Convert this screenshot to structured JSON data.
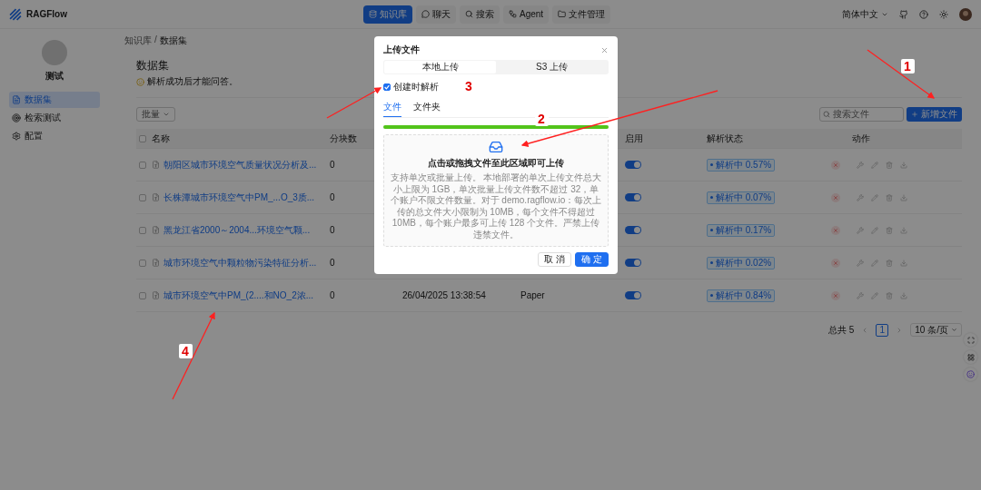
{
  "header": {
    "logo": "RAGFlow",
    "nav": [
      {
        "label": "知识库",
        "selected": true
      },
      {
        "label": "聊天",
        "selected": false
      },
      {
        "label": "搜索",
        "selected": false
      },
      {
        "label": "Agent",
        "selected": false
      },
      {
        "label": "文件管理",
        "selected": false
      }
    ],
    "language": "简体中文"
  },
  "sidebar": {
    "name": "测试",
    "items": [
      {
        "label": "数据集",
        "selected": true
      },
      {
        "label": "检索测试",
        "selected": false
      },
      {
        "label": "配置",
        "selected": false
      }
    ]
  },
  "breadcrumb": {
    "items": [
      "知识库",
      "数据集"
    ],
    "separator": "/"
  },
  "page": {
    "title": "数据集",
    "subtitle": "解析成功后才能问答。"
  },
  "toolbar": {
    "batch": "批量",
    "search_placeholder": "搜索文件",
    "add_button": "新增文件"
  },
  "table": {
    "select_all_checked": false,
    "columns": [
      "名称",
      "分块数",
      "",
      "",
      "启用",
      "解析状态",
      "动作"
    ],
    "rows": [
      {
        "checked": false,
        "name": "朝阳区城市环境空气质量状况分析及...",
        "chunks": "0",
        "enabled": true,
        "status": "解析中",
        "progress": "0.57%"
      },
      {
        "checked": false,
        "name": "长株潭城市环境空气中PM_...O_3质...",
        "chunks": "0",
        "enabled": true,
        "status": "解析中",
        "progress": "0.07%"
      },
      {
        "checked": false,
        "name": "黑龙江省2000～2004...环境空气颗...",
        "chunks": "0",
        "enabled": true,
        "status": "解析中",
        "progress": "0.17%"
      },
      {
        "checked": false,
        "name": "城市环境空气中颗粒物污染特征分析...",
        "chunks": "0",
        "enabled": true,
        "status": "解析中",
        "progress": "0.02%"
      },
      {
        "checked": false,
        "name": "城市环境空气中PM_(2....和NO_2浓...",
        "chunks": "0",
        "date": "26/04/2025 13:38:54",
        "method": "Paper",
        "enabled": true,
        "status": "解析中",
        "progress": "0.84%"
      }
    ]
  },
  "pagination": {
    "total": "总共 5",
    "pages": [
      {
        "label": "1",
        "selected": true
      }
    ],
    "page_size": "10 条/页"
  },
  "dialog": {
    "title": "上传文件",
    "modes": [
      {
        "label": "本地上传",
        "selected": true
      },
      {
        "label": "S3 上传",
        "selected": false
      }
    ],
    "parse_on_create": {
      "label": "创建时解析",
      "checked": true
    },
    "tabs": [
      {
        "label": "文件",
        "selected": true
      },
      {
        "label": "文件夹",
        "selected": false
      }
    ],
    "progress": {
      "level": 1
    },
    "dropzone": {
      "title": "点击或拖拽文件至此区域即可上传",
      "hint": "支持单次或批量上传。 本地部署的单次上传文件总大小上限为 1GB，单次批量上传文件数不超过 32，单个账户不限文件数量。对于 demo.ragflow.io：每次上传的总文件大小限制为 10MB，每个文件不得超过 10MB，每个账户最多可上传 128 个文件。严禁上传违禁文件。"
    },
    "buttons": [
      {
        "label": "取 消",
        "kind": "default"
      },
      {
        "label": "确 定",
        "kind": "primary"
      }
    ]
  },
  "annotations": [
    "1",
    "2",
    "3",
    "4"
  ]
}
